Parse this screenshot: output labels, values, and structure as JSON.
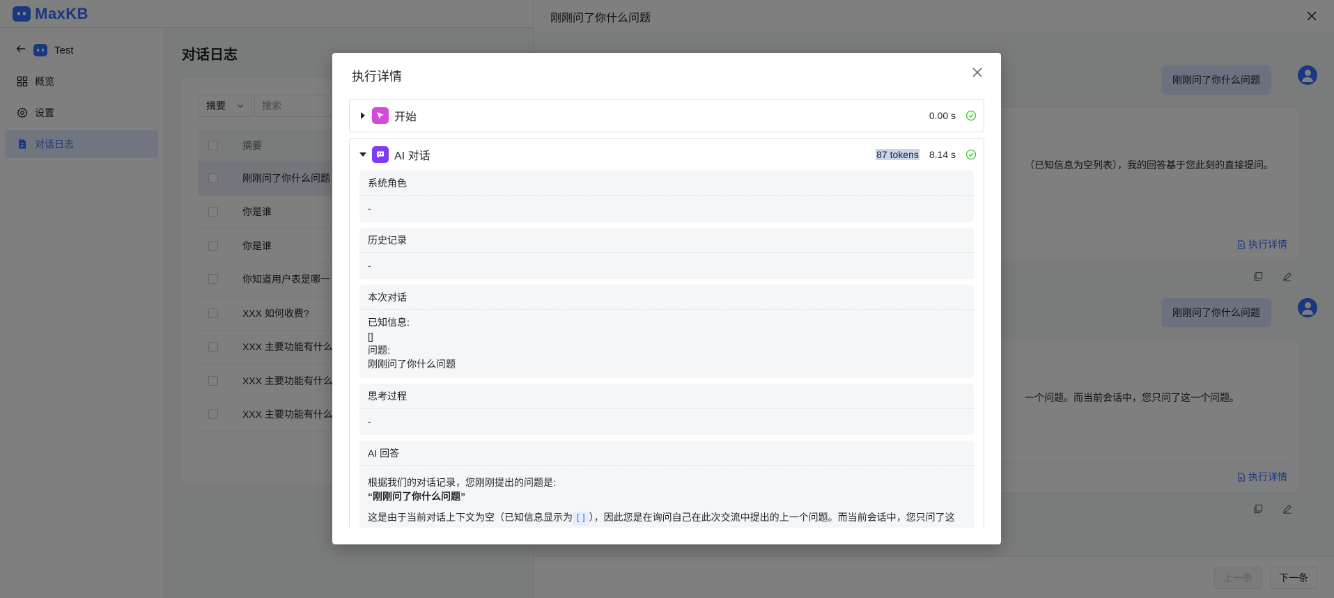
{
  "brand": {
    "name": "MaxKB",
    "accent": "#3370ff"
  },
  "sidebar": {
    "app_name": "Test",
    "items": [
      {
        "label": "概览",
        "icon": "grid-icon"
      },
      {
        "label": "设置",
        "icon": "gear-icon"
      },
      {
        "label": "对话日志",
        "icon": "document-icon",
        "active": true
      }
    ]
  },
  "main": {
    "title": "对话日志",
    "filter": {
      "select_value": "摘要",
      "search_placeholder": "搜索"
    },
    "table": {
      "header": "摘要",
      "rows": [
        "刚刚问了你什么问题",
        "你是谁",
        "你是谁",
        "你知道用户表是哪一",
        "XXX 如何收费?",
        "XXX 主要功能有什么",
        "XXX 主要功能有什么",
        "XXX 主要功能有什么"
      ]
    }
  },
  "drawer": {
    "title": "刚刚问了你什么问题",
    "messages": [
      {
        "question": "刚刚问了你什么问题",
        "answer_visible": "（已知信息为空列表），我的回答基于您此刻的直接提问。",
        "exec_label": "执行详情"
      },
      {
        "question": "刚刚问了你什么问题",
        "answer_visible": "一个问题。而当前会话中，您只问了这一个问题。",
        "exec_label": "执行详情"
      }
    ],
    "prev_label": "上一条",
    "next_label": "下一条"
  },
  "modal": {
    "title": "执行详情",
    "steps": [
      {
        "name": "开始",
        "time": "0.00 s",
        "status": "success",
        "icon": "pointer-icon",
        "expanded": false
      },
      {
        "name": "AI 对话",
        "tokens": "87 tokens",
        "time": "8.14 s",
        "status": "success",
        "icon": "chat-bubble-icon",
        "expanded": true,
        "blocks": {
          "system_role": {
            "title": "系统角色",
            "content": "-"
          },
          "history": {
            "title": "历史记录",
            "content": "-"
          },
          "current": {
            "title": "本次对话",
            "line1": "已知信息:",
            "line2": "[]",
            "line3": "问题:",
            "line4": "刚刚问了你什么问题"
          },
          "thinking": {
            "title": "思考过程",
            "content": "-"
          },
          "answer": {
            "title": "AI 回答",
            "line1": "根据我们的对话记录，您刚刚提出的问题是:",
            "line2": "“刚刚问了你什么问题”",
            "line3_before": "这是由于当前对话上下文为空（已知信息显示为",
            "line3_code": "[]",
            "line3_after": "），因此您是在询问自己在此次交流中提出的上一个问题。而当前会话中，您只问了这"
          }
        }
      }
    ]
  },
  "colors": {
    "start_icon": "#d44bd9",
    "ai_icon": "#7f3bf5",
    "success": "#34c724",
    "overlay": "rgba(0,0,0,0.5)"
  }
}
